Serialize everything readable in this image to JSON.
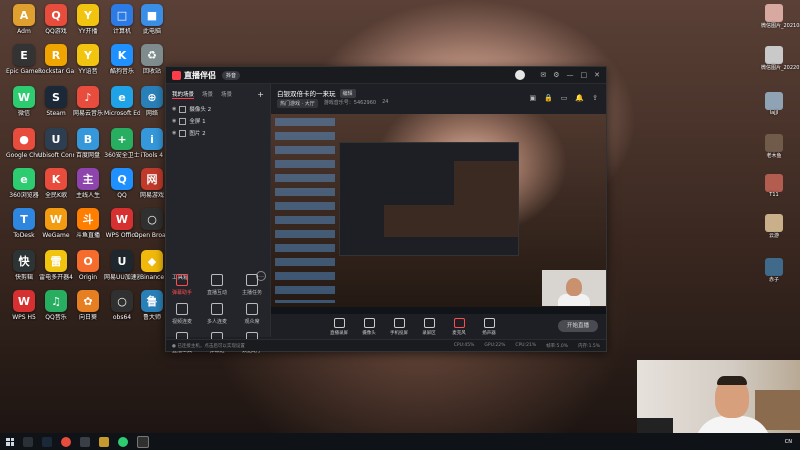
{
  "desktop": {
    "icons": [
      {
        "label": "Adm",
        "color": "#e0a030",
        "glyph": "A"
      },
      {
        "label": "QQ游戏",
        "color": "#e74c3c",
        "glyph": "Q"
      },
      {
        "label": "YY开播",
        "color": "#f1c40f",
        "glyph": "Y"
      },
      {
        "label": "计算机",
        "color": "#2c7be5",
        "glyph": "□"
      },
      {
        "label": "此电脑",
        "color": "#3a8ee6",
        "glyph": "■"
      },
      {
        "label": "Epic Games Launcher",
        "color": "#333333",
        "glyph": "E"
      },
      {
        "label": "Rockstar Games...",
        "color": "#f0a400",
        "glyph": "R"
      },
      {
        "label": "YY语音",
        "color": "#f1c40f",
        "glyph": "Y"
      },
      {
        "label": "酷狗音乐",
        "color": "#1e90ff",
        "glyph": "K"
      },
      {
        "label": "回收站",
        "color": "#7f8c8d",
        "glyph": "♻"
      },
      {
        "label": "微信",
        "color": "#2ecc71",
        "glyph": "W"
      },
      {
        "label": "Steam",
        "color": "#1b2838",
        "glyph": "S"
      },
      {
        "label": "网易云音乐",
        "color": "#e74c3c",
        "glyph": "♪"
      },
      {
        "label": "Microsoft Edge",
        "color": "#1fa3e6",
        "glyph": "e"
      },
      {
        "label": "网络",
        "color": "#2980b9",
        "glyph": "⊕"
      },
      {
        "label": "Google Chrome",
        "color": "#e74c3c",
        "glyph": "●"
      },
      {
        "label": "Ubisoft Connect",
        "color": "#2c3e50",
        "glyph": "U"
      },
      {
        "label": "百度网盘",
        "color": "#3498db",
        "glyph": "B"
      },
      {
        "label": "360安全卫士",
        "color": "#27ae60",
        "glyph": "+"
      },
      {
        "label": "iTools 4",
        "color": "#3498db",
        "glyph": "i"
      },
      {
        "label": "360浏览器",
        "color": "#2ecc71",
        "glyph": "e"
      },
      {
        "label": "全民K歌",
        "color": "#e74c3c",
        "glyph": "K"
      },
      {
        "label": "主线人生",
        "color": "#8e44ad",
        "glyph": "主"
      },
      {
        "label": "QQ",
        "color": "#1e90ff",
        "glyph": "Q"
      },
      {
        "label": "网易游戏",
        "color": "#c0392b",
        "glyph": "网"
      },
      {
        "label": "ToDesk",
        "color": "#2e86de",
        "glyph": "T"
      },
      {
        "label": "WeGame",
        "color": "#f39c12",
        "glyph": "W"
      },
      {
        "label": "斗鱼直播",
        "color": "#ff7e00",
        "glyph": "斗"
      },
      {
        "label": "WPS Office",
        "color": "#d63031",
        "glyph": "W"
      },
      {
        "label": "Open Broadcast...",
        "color": "#303030",
        "glyph": "○"
      },
      {
        "label": "快剪辑",
        "color": "#2d3436",
        "glyph": "快"
      },
      {
        "label": "雷电多开器4",
        "color": "#f1c40f",
        "glyph": "雷"
      },
      {
        "label": "Origin",
        "color": "#f56c2d",
        "glyph": "O"
      },
      {
        "label": "网易UU加速器",
        "color": "#1e272e",
        "glyph": "U"
      },
      {
        "label": "Binance",
        "color": "#f0b90b",
        "glyph": "◆"
      },
      {
        "label": "WPS H5",
        "color": "#d63031",
        "glyph": "W"
      },
      {
        "label": "QQ音乐",
        "color": "#27ae60",
        "glyph": "♫"
      },
      {
        "label": "向日葵",
        "color": "#e67e22",
        "glyph": "✿"
      },
      {
        "label": "obs64",
        "color": "#303030",
        "glyph": "○"
      },
      {
        "label": "鲁大师",
        "color": "#2980b9",
        "glyph": "鲁"
      }
    ],
    "side_thumbs": [
      "微信图片_2021082...",
      "微信图片_2022011...",
      "lajjl",
      "老木鱼",
      "T11",
      "云游",
      "赤子"
    ]
  },
  "app": {
    "brand": "直播伴侣",
    "tag": "抖音",
    "tabs": [
      "我的场景",
      "场景",
      "场景",
      "可改变"
    ],
    "sources": [
      "摄像头 2",
      "全屏 1",
      "图片 2"
    ],
    "tools_title": "工具箱",
    "tools": [
      {
        "label": "弹幕助手",
        "red": true
      },
      {
        "label": "直播互动",
        "red": false
      },
      {
        "label": "主播任务",
        "red": false
      },
      {
        "label": "视频连麦",
        "red": false
      },
      {
        "label": "多人连麦",
        "red": false
      },
      {
        "label": "观众席",
        "red": false
      },
      {
        "label": "直播工具",
        "red": false
      },
      {
        "label": "弹幕姬",
        "red": false
      },
      {
        "label": "数据助手",
        "red": false
      }
    ],
    "room_title": "白银双倍卡的一来玩",
    "room_edit": "编辑",
    "room_category": "热门游戏 · 大厅",
    "room_meta": [
      "游戏音乐号：5462960",
      "24"
    ],
    "top_icons": [
      "▣",
      "🔒",
      "▭",
      "🔔",
      "⇪"
    ],
    "controls": [
      "直播录屏",
      "摄像头",
      "手机投屏",
      "录屏区",
      "麦克风",
      "扬声器"
    ],
    "go_live": "开始直播",
    "status_left": "● 已连接主机，点击后可以实现设置",
    "status_right": [
      "CPU:45%",
      "GPU:22%",
      "CPU:21%",
      "帧率:5.0%",
      "内存:1.5%"
    ]
  },
  "taskbar": {
    "time": "CN",
    "icons": [
      "search",
      "chrome",
      "steam",
      "app1",
      "app2",
      "app3",
      "obs"
    ]
  }
}
